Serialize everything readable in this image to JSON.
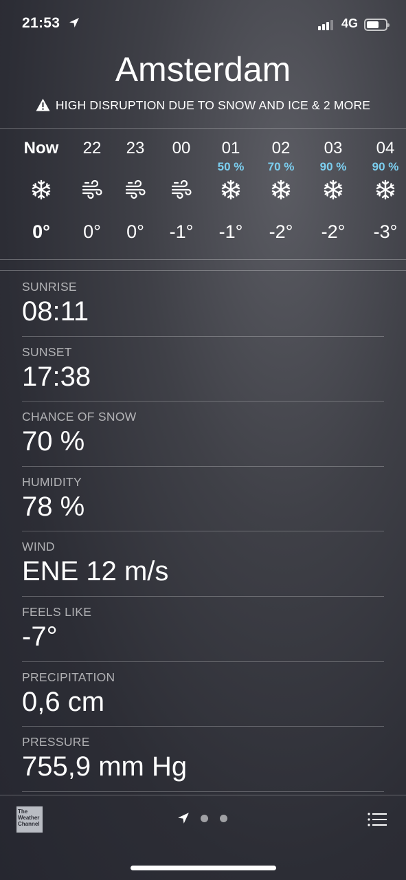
{
  "status_bar": {
    "time": "21:53",
    "network": "4G",
    "icons": [
      "location-arrow-icon",
      "signal-bars-icon",
      "battery-icon"
    ]
  },
  "header": {
    "city": "Amsterdam",
    "alert": "HIGH DISRUPTION DUE TO SNOW AND ICE & 2 MORE",
    "alert_icon": "warning-icon"
  },
  "hourly": [
    {
      "label": "Now",
      "precip": "",
      "icon": "snowflake-icon",
      "temp": "0°"
    },
    {
      "label": "22",
      "precip": "",
      "icon": "wind-icon",
      "temp": "0°"
    },
    {
      "label": "23",
      "precip": "",
      "icon": "wind-icon",
      "temp": "0°"
    },
    {
      "label": "00",
      "precip": "",
      "icon": "wind-icon",
      "temp": "-1°"
    },
    {
      "label": "01",
      "precip": "50 %",
      "icon": "snowflake-icon",
      "temp": "-1°"
    },
    {
      "label": "02",
      "precip": "70 %",
      "icon": "snowflake-icon",
      "temp": "-2°"
    },
    {
      "label": "03",
      "precip": "90 %",
      "icon": "snowflake-icon",
      "temp": "-2°"
    },
    {
      "label": "04",
      "precip": "90 %",
      "icon": "snowflake-icon",
      "temp": "-3°"
    }
  ],
  "details": [
    {
      "label": "SUNRISE",
      "value": "08:11"
    },
    {
      "label": "SUNSET",
      "value": "17:38"
    },
    {
      "label": "CHANCE OF SNOW",
      "value": "70 %"
    },
    {
      "label": "HUMIDITY",
      "value": "78 %"
    },
    {
      "label": "WIND",
      "value": "ENE 12 m/s"
    },
    {
      "label": "FEELS LIKE",
      "value": "-7°"
    },
    {
      "label": "PRECIPITATION",
      "value": "0,6 cm"
    },
    {
      "label": "PRESSURE",
      "value": "755,9 mm Hg"
    }
  ],
  "bottom_bar": {
    "logo_text": "The Weather Channel",
    "icons": [
      "location-arrow-icon",
      "list-icon"
    ]
  },
  "colors": {
    "precip_accent": "#7ccff0"
  }
}
